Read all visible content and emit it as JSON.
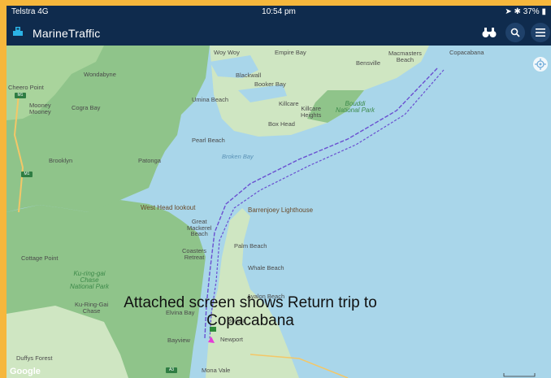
{
  "status_bar": {
    "carrier": "Telstra  4G",
    "time": "10:54 pm",
    "battery": "37%"
  },
  "app": {
    "title": "MarineTraffic"
  },
  "icons": {
    "logo": "ship-logo-icon",
    "binoculars": "binoculars-icon",
    "search": "search-icon",
    "menu": "hamburger-menu-icon",
    "locate": "locate-icon"
  },
  "colors": {
    "header_bg": "#0f2b4d",
    "water": "#a9d6ea",
    "land": "#cfe6c2",
    "park": "#8fc48a",
    "track": "#6a4fd0",
    "border": "#f6b73c"
  },
  "map_labels": {
    "woy_woy": "Woy Woy",
    "empire_bay": "Empire Bay",
    "bensville": "Bensville",
    "macmasters_beach": "Macmasters\nBeach",
    "copacabana": "Copacabana",
    "cheero_point": "Cheero Point",
    "wondabyne": "Wondabyne",
    "blackwall": "Blackwall",
    "booker_bay": "Booker Bay",
    "mooney_mooney": "Mooney\nMooney",
    "cogra_bay": "Cogra Bay",
    "umina_beach": "Umina Beach",
    "killcare": "Killcare",
    "killcare_heights": "Killcare\nHeights",
    "bouddi_national_park": "Bouddi\nNational Park",
    "box_head": "Box Head",
    "pearl_beach": "Pearl Beach",
    "brooklyn": "Brooklyn",
    "patonga": "Patonga",
    "broken_bay": "Broken Bay",
    "west_head_lookout": "West Head lookout",
    "barrenjoey_lighthouse": "Barrenjoey Lighthouse",
    "great_mackerel_beach": "Great\nMackerel\nBeach",
    "palm_beach": "Palm Beach",
    "coasters_retreat": "Coasters\nRetreat",
    "whale_beach": "Whale Beach",
    "cottage_point": "Cottage Point",
    "ku_ring_gai_chase_np": "Ku-ring-gai\nChase\nNational Park",
    "ku_ring_gai_chase": "Ku-Ring-Gai\nChase",
    "elvina_bay": "Elvina Bay",
    "avalon_beach": "Avalon Beach",
    "bilgola": "Bilgola",
    "newport": "Newport",
    "bayview": "Bayview",
    "duffys_forest": "Duffys Forest",
    "mona_vale": "Mona Vale",
    "google": "Google",
    "m1_a": "M1",
    "m1_b": "M1",
    "a3": "A3"
  },
  "caption": "Attached screen shows Return trip to Copacabana"
}
